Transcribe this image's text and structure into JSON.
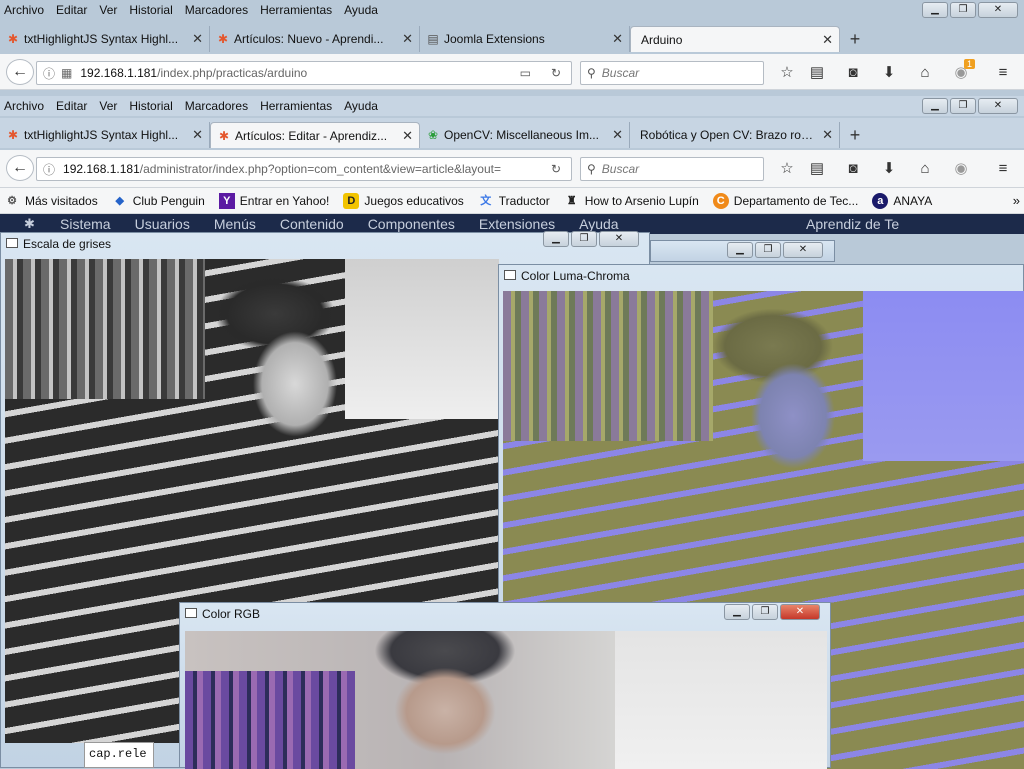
{
  "menu": [
    "Archivo",
    "Editar",
    "Ver",
    "Historial",
    "Marcadores",
    "Herramientas",
    "Ayuda"
  ],
  "back_browser": {
    "tabs": [
      {
        "label": "txtHighlightJS Syntax Highl...",
        "icon": "joomla-icon"
      },
      {
        "label": "Artículos: Nuevo - Aprendi...",
        "icon": "joomla-icon"
      },
      {
        "label": "Joomla Extensions",
        "icon": "page-icon"
      },
      {
        "label": "Arduino",
        "icon": ""
      }
    ],
    "url_host": "192.168.1.181",
    "url_path": "/index.php/practicas/arduino",
    "search_placeholder": "Buscar",
    "badge": "1"
  },
  "front_browser": {
    "tabs": [
      {
        "label": "txtHighlightJS Syntax Highl...",
        "icon": "joomla-icon"
      },
      {
        "label": "Artículos: Editar - Aprendiz...",
        "icon": "joomla-icon"
      },
      {
        "label": "OpenCV: Miscellaneous Im...",
        "icon": "opencv-icon"
      },
      {
        "label": "Robótica y Open CV: Brazo rob...",
        "icon": ""
      }
    ],
    "url_host": "192.168.1.181",
    "url_path": "/administrator/index.php?option=com_content&view=article&layout=",
    "search_placeholder": "Buscar"
  },
  "bookmarks": [
    {
      "label": "Más visitados",
      "icon": "gear-icon"
    },
    {
      "label": "Club Penguin",
      "icon": "penguin-icon"
    },
    {
      "label": "Entrar en Yahoo!",
      "icon": "yahoo-icon"
    },
    {
      "label": "Juegos educativos",
      "icon": "d-icon"
    },
    {
      "label": "Traductor",
      "icon": "translate-icon"
    },
    {
      "label": "How to Arsenio Lupín",
      "icon": "hat-icon"
    },
    {
      "label": "Departamento de Tec...",
      "icon": "c-icon"
    },
    {
      "label": "ANAYA",
      "icon": "anaya-icon"
    }
  ],
  "joomla_menu": [
    "Sistema",
    "Usuarios",
    "Menús",
    "Contenido",
    "Componentes",
    "Extensiones",
    "Ayuda"
  ],
  "joomla_user": "Aprendiz de Te",
  "windows": {
    "gray": {
      "title": "Escala de grises"
    },
    "luma": {
      "title": "Color Luma-Chroma"
    },
    "rgb": {
      "title": "Color RGB"
    }
  },
  "code_snippet": "cap.rele"
}
